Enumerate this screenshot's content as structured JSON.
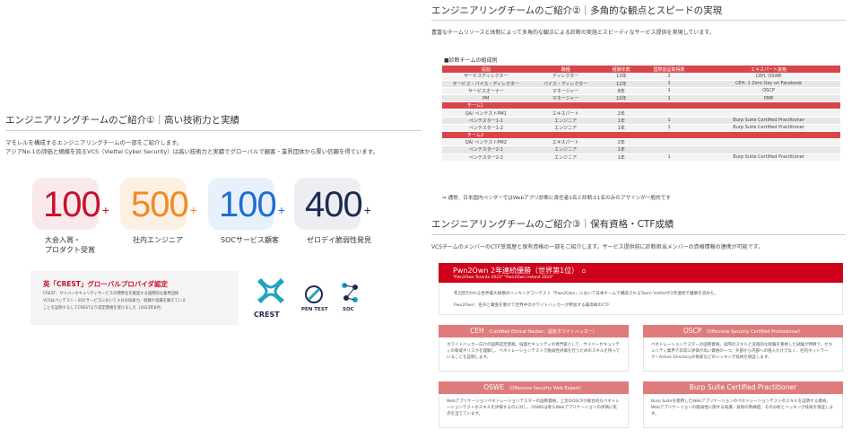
{
  "left": {
    "title": "エンジニアリングチームのご紹介①｜高い技術力と実績",
    "lead_line1": "マモレルを構成するエンジニアリングチームの一部をご紹介します。",
    "lead_line2": "アジアNo.1の評価と規模を誇るVCS（Viettel Cyber Security）は高い技術力と実績でグローバルで顧客・業界団体から厚い信頼を得ています。",
    "stats": [
      {
        "value": "100",
        "suffix": "+",
        "label_line1": "大会入賞・",
        "label_line2": "プロダクト受賞",
        "color": "#c8102e",
        "bg": "#f5d7da",
        "icon": "trophy-icon"
      },
      {
        "value": "500",
        "suffix": "+",
        "label_line1": "社内エンジニア",
        "label_line2": "",
        "color": "#f08a24",
        "bg": "#fbe3cc",
        "icon": "engineer-icon"
      },
      {
        "value": "100",
        "suffix": "+",
        "label_line1": "SOCサービス顧客",
        "label_line2": "",
        "color": "#1e6fd0",
        "bg": "#d6e6f7",
        "icon": "gear-icon"
      },
      {
        "value": "400",
        "suffix": "+",
        "label_line1": "ゼロデイ脆弱性発見",
        "label_line2": "",
        "color": "#1d2b50",
        "bg": "#dde0e8",
        "icon": "bug-icon"
      }
    ],
    "crest": {
      "title": "英「CREST」グローバルプロバイダ認定",
      "line1": "CREST：サイバーセキュリティサービスの標準化を推進する国際的な業界団体",
      "line2": "VCSはペンテスト・SOCサービスにおいて十分な技術力、経験や実績を備えている",
      "line3": "ことを証明するしてCRESTより認定資格を受けました（2023年8月）"
    },
    "logos": {
      "crest": "CREST",
      "pentest": "PEN TEST",
      "soc": "SOC"
    }
  },
  "right": {
    "title2": "エンジニアリングチームのご紹介②｜多角的な観点とスピードの実現",
    "lead2": "豊富なチームリソースと体制によって多角的な観点による診断の実施とスピーディなサービス提供を実現しています。",
    "table_caption": "■診断チームの組成例",
    "table_headers": [
      "役割",
      "職種",
      "経験年数",
      "国際認証取得数",
      "エキスパート資格"
    ],
    "rows": [
      {
        "type": "row",
        "cells": [
          "サービスディレクター",
          "ディレクター",
          "13年",
          "2",
          "CEH, OSWE"
        ]
      },
      {
        "type": "row",
        "cells": [
          "サービス・パイス・ディレクター",
          "パイス・ディレクター",
          "12年",
          "1",
          "CEH, 1 Zero Day on Facebook"
        ]
      },
      {
        "type": "row",
        "cells": [
          "サービスオーナー",
          "マネージャー",
          "8年",
          "1",
          "OSCP"
        ]
      },
      {
        "type": "row",
        "cells": [
          "PM",
          "マネージャー",
          "10年",
          "1",
          "PMP"
        ]
      },
      {
        "type": "group",
        "label": "チーム1"
      },
      {
        "type": "row",
        "cells": [
          "QA/ ペンテストPM1",
          "エキスパート",
          "2年",
          "",
          ""
        ]
      },
      {
        "type": "row",
        "cells": [
          "ペンテスター1-1",
          "エンジニア",
          "1年",
          "1",
          "Burp Suite Certified Practitioner"
        ]
      },
      {
        "type": "row",
        "cells": [
          "ペンテスター1-2",
          "エンジニア",
          "1年",
          "1",
          "Burp Suite Certified Practitioner"
        ]
      },
      {
        "type": "group",
        "label": "チーム2"
      },
      {
        "type": "row",
        "cells": [
          "QA/ ペンテストPM2",
          "エキスパート",
          "2年",
          "",
          ""
        ]
      },
      {
        "type": "row",
        "cells": [
          "ペンテスター2-1",
          "エンジニア",
          "1年",
          "",
          ""
        ]
      },
      {
        "type": "row",
        "cells": [
          "ペンテスター2-2",
          "エンジニア",
          "1年",
          "1",
          "Burp Suite Certified Practitioner"
        ]
      }
    ],
    "table_note": "⇒ 通常、日本国内ベンダーではWebアプリ診断に責任者1名と診断士1名のみのアサインが一般的です",
    "title3": "エンジニアリングチームのご紹介③｜保有資格・CTF成績",
    "lead3": "VCSチームのメンバーのCTF受賞歴と保有資格の一部をご紹介します。サービス提供前に診断担当メンバーの資格情報の連携が可能です。",
    "pwn": {
      "title": "Pwn2Own 2年連続優勝（世界第1位）",
      "title_tag": "Ω",
      "sub": "\"Pwn2Own Toronto 2023\" \"Pwn2Own Ireland 2024\"",
      "body1": "年2回行われる世界最大規模のハッキングコンテスト「Pwn2Own」において日本チームで構成されるTeam Viettelが2年連続で優勝を収めた。",
      "body2": "Pwn2Own：名声と賞金を懸けて世界中のホワイトハッカーが参加する最高峰のCTF"
    },
    "certs": [
      {
        "name": "CEH",
        "sub": "（Certified Ethical Hacker：認定ホワイトハッカー）",
        "desc": "ホワイトハッカー向けの国際認定資格。倫理セキュリティの専門家として、サイバーセキュリティの脅威やリスクを理解し、ペネトレーションテストで脆弱性評価を行うためのスキルを持っていることを証明します。"
      },
      {
        "name": "OSCP",
        "sub": "（Offensive Security Certified Professional）",
        "desc": "ペネトレーションテスターの国際資格。実際のスキルと実践的な経験を重視した試験が特徴で、セキュリティ業界で非常に評価が高い資格の一つ。外部から内部への侵入だけでなく、社内ネットワーク・Active Directoryの探索などのハッキング技術を保証します。"
      },
      {
        "name": "OSWE",
        "sub": "（Offensive Security Web Expert）",
        "desc": "Webアプリケーションペネトレーションテスターの国際資格。上流のOSCPが総合的なペネトレーションテストのスキルを評価するのに対し、OSWEは専らWebアプリケーションの評価に焦点を当てています。"
      },
      {
        "name": "Burp Suite Certified Practitioner",
        "sub": "",
        "desc": "Burp Suiteを使用したWebアプリケーションのペネトレーションテストのスキルを証明する資格。Webアプリケーションの脆弱性に関する知識・技術の熟練度、その分析とハッキング技術を保証します。"
      }
    ]
  }
}
